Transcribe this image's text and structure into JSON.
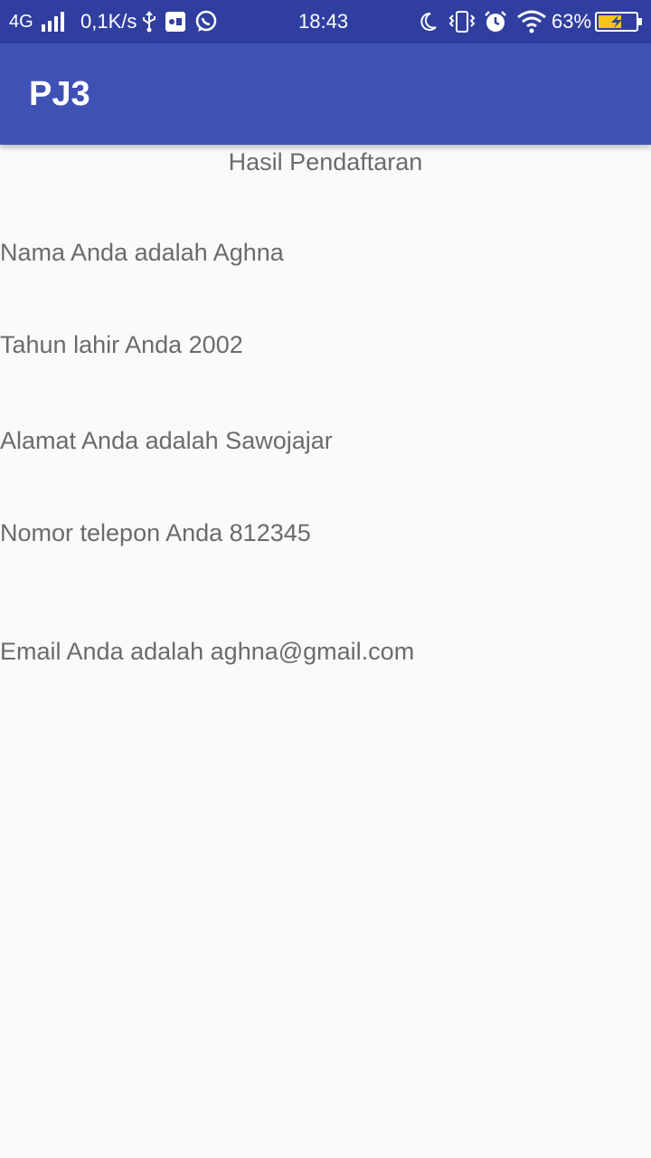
{
  "status_bar": {
    "network": "4G",
    "speed": "0,1K/s",
    "time": "18:43",
    "battery_percent": "63%",
    "battery_level": 0.63,
    "icons": [
      "signal-icon",
      "usb-icon",
      "sd-icon",
      "whatsapp-icon",
      "moon-icon",
      "vibrate-icon",
      "alarm-icon",
      "wifi-icon",
      "battery-icon"
    ]
  },
  "app_bar": {
    "title": "PJ3",
    "color": "#3f51b5",
    "status_color": "#303f9f"
  },
  "result": {
    "heading": "Hasil Pendaftaran",
    "name": "Nama Anda adalah Aghna",
    "birth_year": "Tahun lahir Anda 2002",
    "address": "Alamat Anda adalah Sawojajar",
    "phone": "Nomor telepon Anda 812345",
    "email": "Email Anda adalah aghna@gmail.com"
  }
}
